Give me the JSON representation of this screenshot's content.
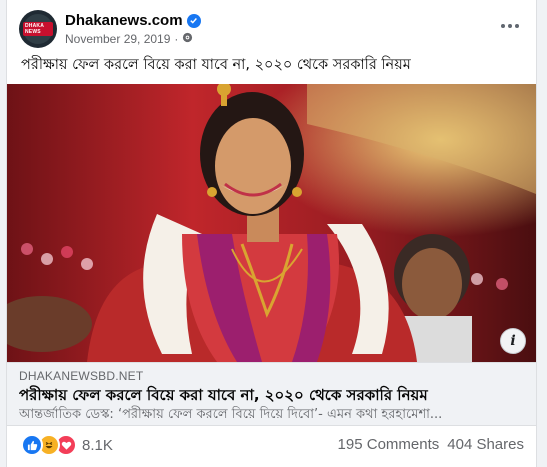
{
  "post": {
    "page_name": "Dhakanews.com",
    "avatar_badge": "DHAKA NEWS",
    "date": "November 29, 2019",
    "meta_separator": "·",
    "text": "পরীক্ষায় ফেল করলে বিয়ে করা যাবে না, ২০২০ থেকে সরকারি নিয়ম"
  },
  "link_preview": {
    "domain": "DHAKANEWSBD.NET",
    "title": "পরীক্ষায় ফেল করলে বিয়ে করা যাবে না, ২০২০ থেকে সরকারি নিয়ম",
    "description": "আন্তর্জাতিক ডেস্ক: ‘পরীক্ষায় ফেল করলে বিয়ে দিয়ে দিবো’- এমন কথা হরহামেশা..."
  },
  "footer": {
    "reaction_count": "8.1K",
    "reactions": [
      "like-icon",
      "haha-icon",
      "love-icon"
    ],
    "comments": "195 Comments",
    "shares": "404 Shares"
  },
  "colors": {
    "accent": "#1877f2",
    "love": "#f33e58",
    "haha": "#f7b125"
  }
}
